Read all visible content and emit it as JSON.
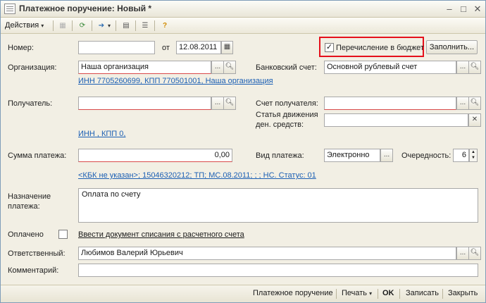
{
  "window": {
    "title": "Платежное поручение: Новый *",
    "minimize": "–",
    "maximize": "□",
    "close": "✕"
  },
  "toolbar": {
    "actions_label": "Действия",
    "arrow": "▾"
  },
  "form": {
    "number_label": "Номер:",
    "number_value": "",
    "from_label": "от",
    "date_value": "12.08.2011",
    "budget_label": "Перечисление в бюджет",
    "budget_checked": "✓",
    "fill_button": "Заполнить...",
    "org_label": "Организация:",
    "org_value": "Наша организация",
    "bank_label": "Банковский счет:",
    "bank_value": "Основной рублевый счет",
    "org_link": "ИНН 7705260699, КПП 770501001, Наша организация",
    "recipient_label": "Получатель:",
    "recipient_value": "",
    "recipient_account_label": "Счет получателя:",
    "recipient_account_value": "",
    "cashflow_label": "Статья движения ден. средств:",
    "cashflow_value": "",
    "recipient_link": "ИНН , КПП 0,",
    "amount_label": "Сумма платежа:",
    "amount_value": "0,00",
    "paytype_label": "Вид платежа:",
    "paytype_value": "Электронно",
    "priority_label": "Очередность:",
    "priority_value": "6",
    "kbk_link": "<КБК не указан>; 15046320212; ТП; МС.08.2011; ; ; НС. Статус: 01",
    "purpose_label": "Назначение платежа:",
    "purpose_value": "Оплата по счету",
    "paid_label": "Оплачено",
    "paid_link": "Ввести документ списания с расчетного счета",
    "responsible_label": "Ответственный:",
    "responsible_value": "Любимов Валерий Юрьевич",
    "comment_label": "Комментарий:",
    "comment_value": ""
  },
  "footer": {
    "payment_order": "Платежное поручение",
    "print": "Печать",
    "print_arrow": "▾",
    "ok": "OK",
    "save": "Записать",
    "close": "Закрыть"
  },
  "colors": {
    "link": "#1b5fb4",
    "highlight": "#e5101b"
  }
}
